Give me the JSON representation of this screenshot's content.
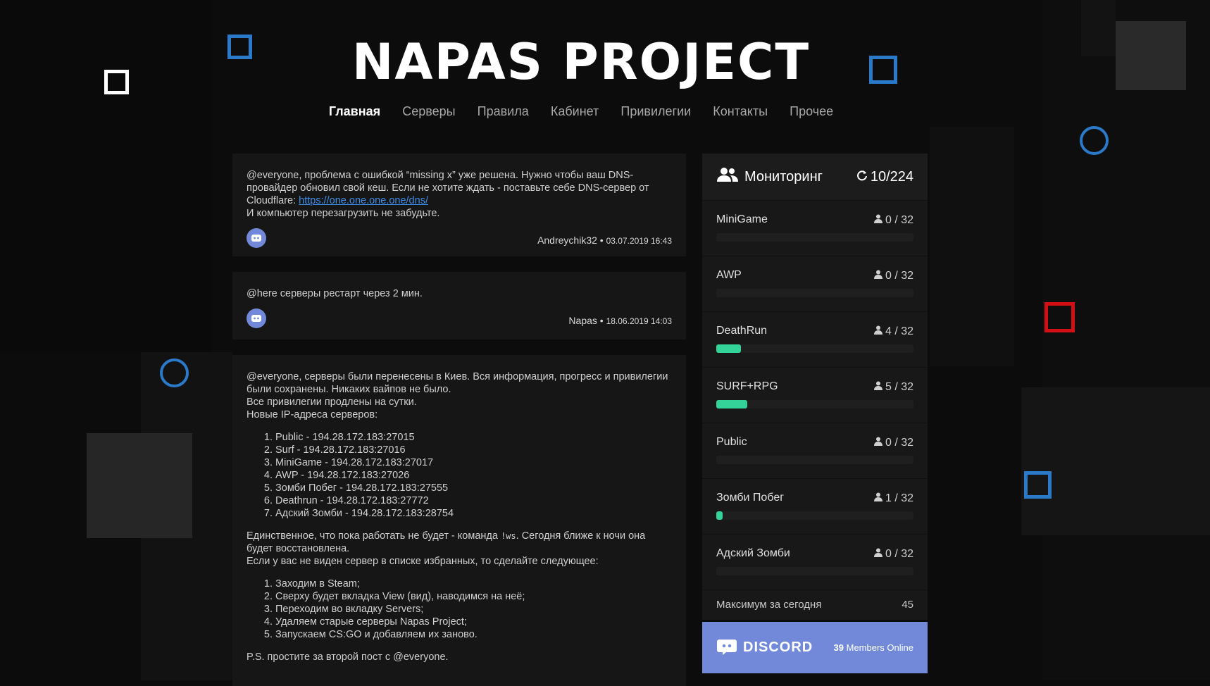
{
  "site": {
    "title": "NAPAS PROJECT"
  },
  "nav": {
    "items": [
      {
        "label": "Главная"
      },
      {
        "label": "Серверы"
      },
      {
        "label": "Правила"
      },
      {
        "label": "Кабинет"
      },
      {
        "label": "Привилегии"
      },
      {
        "label": "Контакты"
      },
      {
        "label": "Прочее"
      }
    ]
  },
  "posts": [
    {
      "line1": "@everyone, проблема с ошибкой “missing x” уже решена. Нужно чтобы ваш DNS-провайдер обновил свой кеш. Если не хотите ждать - поставьте себе DNS-сервер от Cloudflare: ",
      "link": "https://one.one.one.one/dns/",
      "line2": "И компьютер перезагрузить не забудьте.",
      "author": "Andreychik32",
      "date": "03.07.2019 16:43"
    },
    {
      "text": "@here серверы рестарт через 2 мин.",
      "author": "Napas",
      "date": "18.06.2019 14:03"
    },
    {
      "intro1": "@everyone, серверы были перенесены в Киев. Вся информация, прогресс и привилегии были сохранены. Никаких вайпов не было.",
      "intro2": "Все привилегии продлены на сутки.",
      "intro3": "Новые IP-адреса серверов:",
      "ips": [
        "Public - 194.28.172.183:27015",
        "Surf - 194.28.172.183:27016",
        "MiniGame - 194.28.172.183:27017",
        "AWP - 194.28.172.183:27026",
        "Зомби Побег - 194.28.172.183:27555",
        "Deathrun - 194.28.172.183:27772",
        "Адский Зомби - 194.28.172.183:28754"
      ],
      "mid1a": "Единственное, что пока работать не будет - команда ",
      "mid1code": "!ws",
      "mid1b": ". Сегодня ближе к ночи она будет восстановлена.",
      "mid2": "Если у вас не виден сервер в списке избранных, то сделайте следующее:",
      "steps": [
        "Заходим в Steam;",
        "Сверху будет вкладка View (вид), наводимся на неё;",
        "Переходим во вкладку Servers;",
        "Удаляем старые серверы Napas Project;",
        "Запускаем CS:GO и добавляем их заново."
      ],
      "ps": "P.S. простите за второй пост с @everyone."
    }
  ],
  "monitoring": {
    "title": "Мониторинг",
    "total": "10/224",
    "servers": [
      {
        "name": "MiniGame",
        "players": "0 / 32",
        "fill": 0.0
      },
      {
        "name": "AWP",
        "players": "0 / 32",
        "fill": 0.0
      },
      {
        "name": "DeathRun",
        "players": "4 / 32",
        "fill": 0.125
      },
      {
        "name": "SURF+RPG",
        "players": "5 / 32",
        "fill": 0.156
      },
      {
        "name": "Public",
        "players": "0 / 32",
        "fill": 0.0
      },
      {
        "name": "Зомби Побег",
        "players": "1 / 32",
        "fill": 0.031
      },
      {
        "name": "Адский Зомби",
        "players": "0 / 32",
        "fill": 0.0
      }
    ],
    "max_label": "Максимум за сегодня",
    "max_value": "45"
  },
  "discord": {
    "brand": "DISCORD",
    "members": "39",
    "members_label": " Members Online"
  },
  "colors": {
    "accent_green": "#34d399",
    "discord": "#7289da",
    "link": "#3d8ee8"
  }
}
